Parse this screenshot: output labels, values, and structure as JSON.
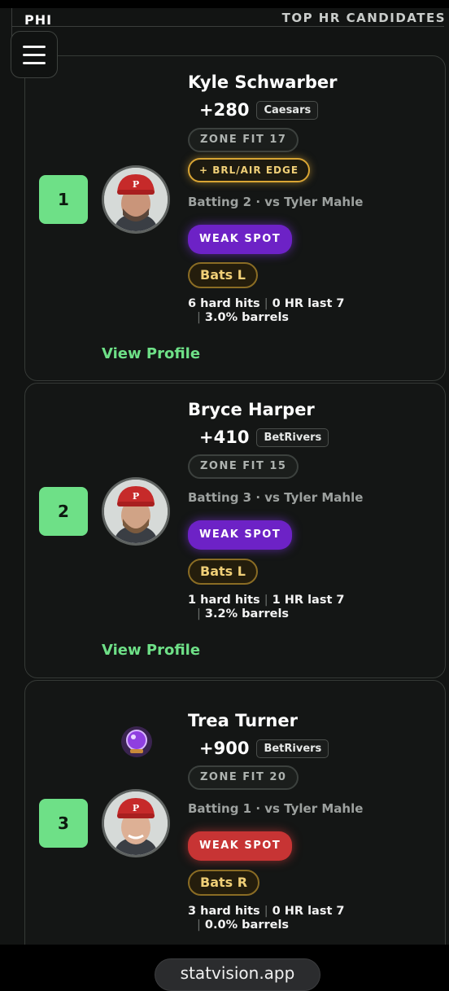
{
  "header": {
    "team": "PHI",
    "section_title": "TOP HR CANDIDATES"
  },
  "players": [
    {
      "rank": "1",
      "name": "Kyle Schwarber",
      "odds": "+280",
      "book": "Caesars",
      "zone_fit": "ZONE FIT 17",
      "edge_badge": "+ BRL/AIR EDGE",
      "batting": "Batting 2 · vs Tyler Mahle",
      "weak_spot": "WEAK SPOT",
      "bats": "Bats L",
      "hard_hits": "6 hard hits",
      "hr_last7": "0 HR last 7",
      "barrels": "3.0% barrels",
      "view_profile": "View Profile",
      "avatar_icon": "player-headshot",
      "weak_spot_color": "#6d22c6"
    },
    {
      "rank": "2",
      "name": "Bryce Harper",
      "odds": "+410",
      "book": "BetRivers",
      "zone_fit": "ZONE FIT 15",
      "batting": "Batting 3 · vs Tyler Mahle",
      "weak_spot": "WEAK SPOT",
      "bats": "Bats L",
      "hard_hits": "1 hard hits",
      "hr_last7": "1 HR last 7",
      "barrels": "3.2% barrels",
      "view_profile": "View Profile",
      "avatar_icon": "player-headshot",
      "weak_spot_color": "#6d22c6"
    },
    {
      "rank": "3",
      "name": "Trea Turner",
      "odds": "+900",
      "book": "BetRivers",
      "zone_fit": "ZONE FIT 20",
      "batting": "Batting 1 · vs Tyler Mahle",
      "weak_spot": "WEAK SPOT",
      "bats": "Bats R",
      "hard_hits": "3 hard hits",
      "hr_last7": "0 HR last 7",
      "barrels": "0.0% barrels",
      "avatar_icon": "player-headshot",
      "badge_icon": "crystal-ball-icon",
      "weak_spot_color": "#c73434"
    }
  ],
  "browser": {
    "url": "statvision.app"
  },
  "colors": {
    "accent_green": "#6ee087",
    "gold": "#f0cf77",
    "background": "#121413"
  }
}
